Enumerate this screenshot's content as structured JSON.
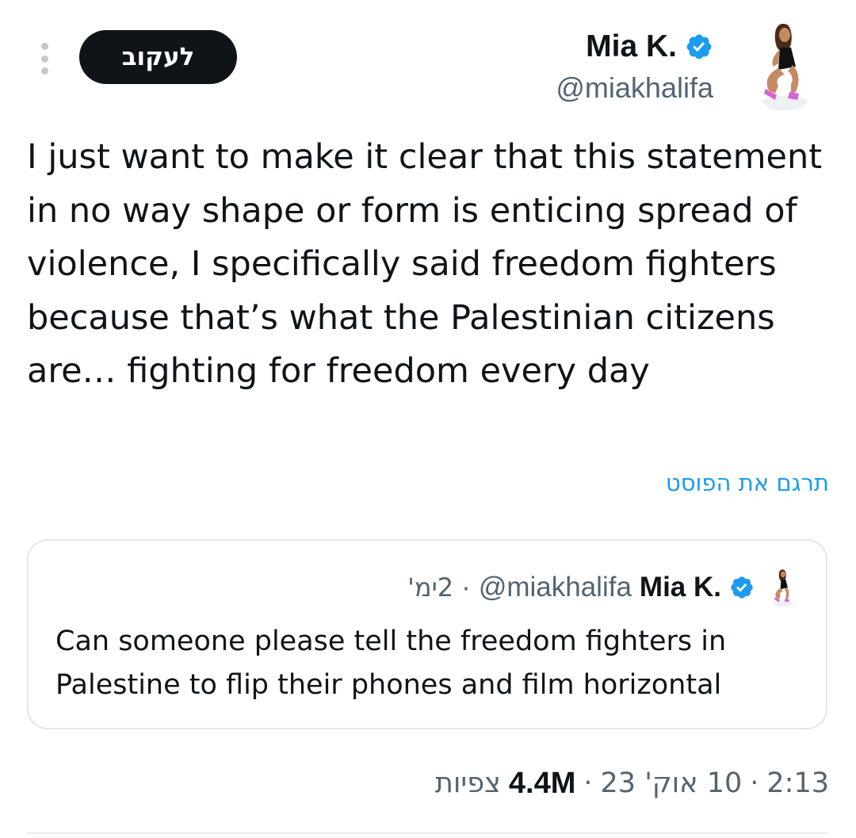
{
  "author": {
    "display_name": "Mia K.",
    "handle": "@miakhalifa",
    "verified": true
  },
  "actions": {
    "follow_label": "לעקוב",
    "more_icon": "more-vertical-icon"
  },
  "tweet": {
    "text": "I just want to make it clear that this statement in no way shape or form is enticing spread of violence, I specifically said freedom fighters because that’s what the Palestinian citizens are… fighting for freedom every day",
    "translate_label": "תרגם את הפוסט"
  },
  "quoted_tweet": {
    "display_name": "Mia K.",
    "handle": "@miakhalifa",
    "separator": "·",
    "time_ago": "2ימ'",
    "text": "Can someone please tell the freedom fighters in Palestine to flip their phones and film horizontal"
  },
  "meta": {
    "time": "2:13",
    "separator": "·",
    "date": "10 אוק' 23",
    "views_count": "4.4M",
    "views_label": "צפיות"
  },
  "colors": {
    "accent": "#1d9bf0",
    "text": "#0f1419",
    "secondary": "#536471",
    "border": "#e3e7ea"
  }
}
